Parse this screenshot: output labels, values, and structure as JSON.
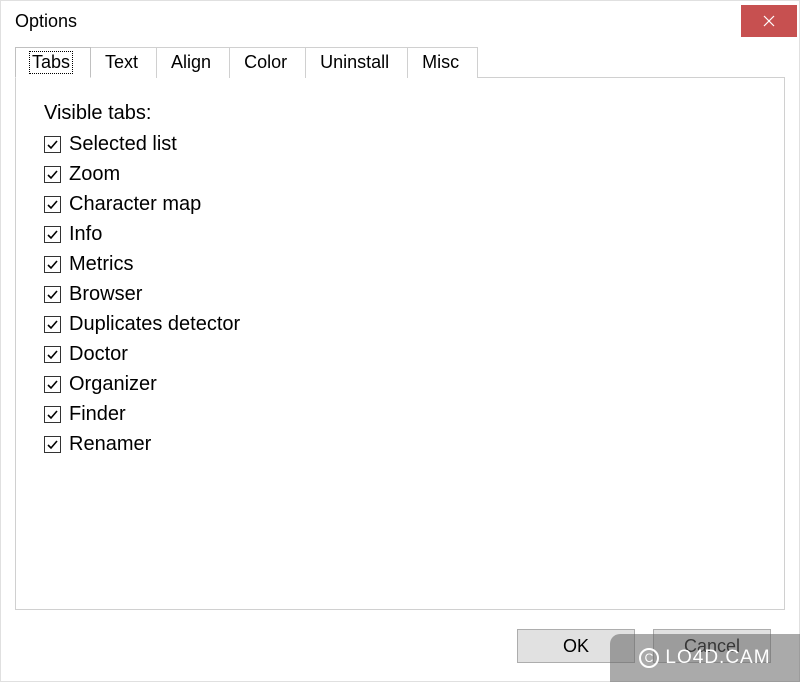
{
  "window": {
    "title": "Options"
  },
  "tabs": [
    {
      "label": "Tabs",
      "active": true
    },
    {
      "label": "Text",
      "active": false
    },
    {
      "label": "Align",
      "active": false
    },
    {
      "label": "Color",
      "active": false
    },
    {
      "label": "Uninstall",
      "active": false
    },
    {
      "label": "Misc",
      "active": false
    }
  ],
  "tabs_panel": {
    "section_label": "Visible tabs:",
    "items": [
      {
        "label": "Selected list",
        "checked": true
      },
      {
        "label": "Zoom",
        "checked": true
      },
      {
        "label": "Character map",
        "checked": true
      },
      {
        "label": "Info",
        "checked": true
      },
      {
        "label": "Metrics",
        "checked": true
      },
      {
        "label": "Browser",
        "checked": true
      },
      {
        "label": "Duplicates detector",
        "checked": true
      },
      {
        "label": "Doctor",
        "checked": true
      },
      {
        "label": "Organizer",
        "checked": true
      },
      {
        "label": "Finder",
        "checked": true
      },
      {
        "label": "Renamer",
        "checked": true
      }
    ]
  },
  "buttons": {
    "ok": "OK",
    "cancel": "Cancel"
  },
  "watermark": {
    "text": "LO4D.CAM"
  }
}
